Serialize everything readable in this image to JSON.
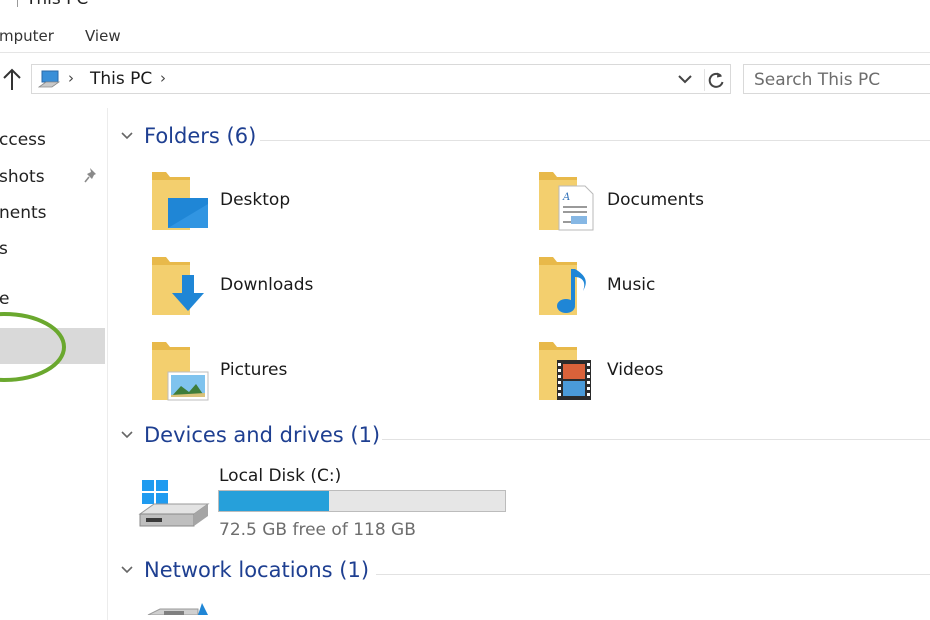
{
  "window": {
    "title": "This PC"
  },
  "ribbon": {
    "tabs": [
      "mputer",
      "View"
    ]
  },
  "address": {
    "path": "This PC"
  },
  "search": {
    "placeholder": "Search This PC"
  },
  "sidebar": {
    "items": [
      "ccess",
      "shots",
      "nents",
      "s",
      "e",
      "",
      ""
    ]
  },
  "groups": {
    "folders": {
      "title": "Folders (6)",
      "items": [
        "Desktop",
        "Documents",
        "Downloads",
        "Music",
        "Pictures",
        "Videos"
      ]
    },
    "devices": {
      "title": "Devices and drives (1)",
      "drive": {
        "name": "Local Disk (C:)",
        "free_text": "72.5 GB free of 118 GB",
        "used_fraction": 0.386
      }
    },
    "network": {
      "title": "Network locations (1)"
    }
  },
  "colors": {
    "accent_title": "#1e3f91",
    "progress": "#26a0da",
    "highlight_circle": "#6aa82e",
    "folder": "#f3cf6e"
  }
}
